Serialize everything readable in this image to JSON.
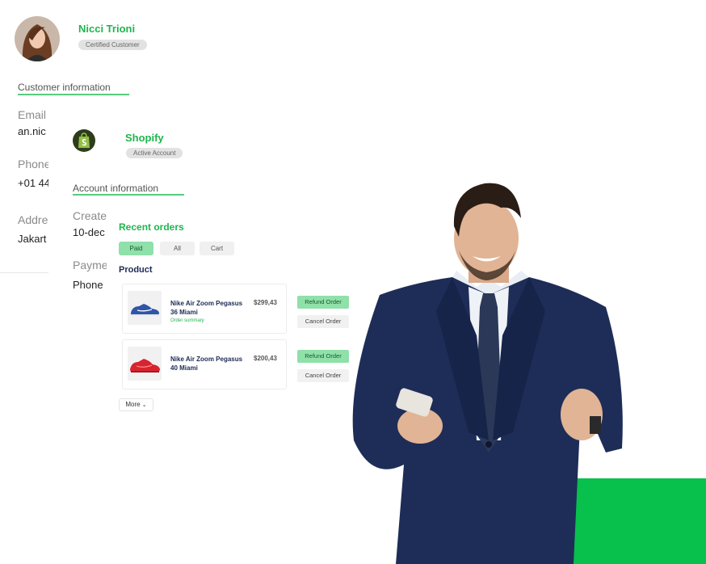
{
  "customer": {
    "name": "Nicci Trioni",
    "status": "Certified Customer",
    "section_title": "Customer information",
    "fields": [
      {
        "label": "Email",
        "value": "an.nic"
      },
      {
        "label": "Phone",
        "value": "+01 44"
      },
      {
        "label": "Address",
        "value": "Jakart"
      }
    ]
  },
  "shopify": {
    "name": "Shopify",
    "status": "Active Account",
    "section_title": "Account information",
    "fields": [
      {
        "label": "Created",
        "value": "10-dec"
      },
      {
        "label": "Payment",
        "value": "Phone"
      }
    ]
  },
  "orders": {
    "title": "Recent orders",
    "tabs": [
      {
        "label": "Paid",
        "active": true
      },
      {
        "label": "All",
        "active": false
      },
      {
        "label": "Cart",
        "active": false
      }
    ],
    "product_header": "Product",
    "items": [
      {
        "name": "Nike Air Zoom Pegasus 36 Miami",
        "price": "$299,43",
        "summary": "Order summary",
        "refund": "Refund Order",
        "cancel": "Cancel Order",
        "shoe_color": "#2f56a8"
      },
      {
        "name": "Nike Air  Zoom Pegasus 40 Miami",
        "price": "$200,43",
        "summary": "",
        "refund": "Refund Order",
        "cancel": "Cancel Order",
        "shoe_color": "#d8242f"
      }
    ],
    "more_label": "More",
    "more_icon": "chevron-down-icon"
  },
  "colors": {
    "accent": "#1fb54e",
    "accent_block": "#08c04c",
    "chip_active": "#8fe0a9"
  }
}
